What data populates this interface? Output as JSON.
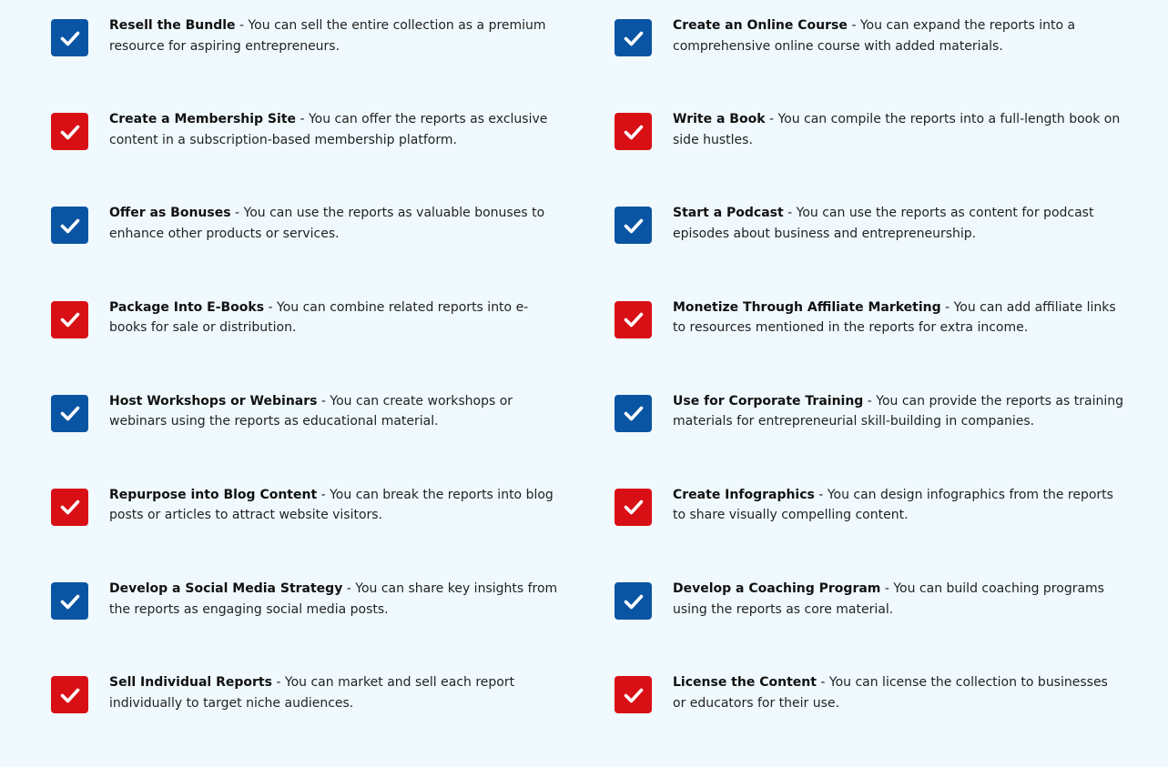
{
  "colors": {
    "background": "#f0fafe",
    "blue": "#0a55a3",
    "red": "#d90f16",
    "check": "#ffffff"
  },
  "separator": " - ",
  "items": [
    {
      "title": "Resell the Bundle",
      "desc": "You can sell the entire collection as a premium resource for aspiring entrepreneurs.",
      "color": "blue",
      "icon": "checkmark-icon"
    },
    {
      "title": "Create an Online Course",
      "desc": "You can expand the reports into a comprehensive online course with added materials.",
      "color": "blue",
      "icon": "checkmark-icon"
    },
    {
      "title": "Create a Membership Site",
      "desc": "You can offer the reports as exclusive content in a subscription-based membership platform.",
      "color": "red",
      "icon": "checkmark-icon"
    },
    {
      "title": "Write a Book",
      "desc": "You can compile the reports into a full-length book on side hustles.",
      "color": "red",
      "icon": "checkmark-icon"
    },
    {
      "title": "Offer as Bonuses",
      "desc": "You can use the reports as valuable bonuses to enhance other products or services.",
      "color": "blue",
      "icon": "checkmark-icon"
    },
    {
      "title": "Start a Podcast",
      "desc": "You can use the reports as content for podcast episodes about business and entrepreneurship.",
      "color": "blue",
      "icon": "checkmark-icon"
    },
    {
      "title": "Package Into E-Books",
      "desc": "You can combine related reports into e-books for sale or distribution.",
      "color": "red",
      "icon": "checkmark-icon"
    },
    {
      "title": "Monetize Through Affiliate Marketing",
      "desc": "You can add affiliate links to resources mentioned in the reports for extra income.",
      "color": "red",
      "icon": "checkmark-icon"
    },
    {
      "title": "Host Workshops or Webinars",
      "desc": "You can create workshops or webinars using the reports as educational material.",
      "color": "blue",
      "icon": "checkmark-icon"
    },
    {
      "title": "Use for Corporate Training",
      "desc": "You can provide the reports as training materials for entrepreneurial skill-building in companies.",
      "color": "blue",
      "icon": "checkmark-icon"
    },
    {
      "title": "Repurpose into Blog Content",
      "desc": "You can break the reports into blog posts or articles to attract website visitors.",
      "color": "red",
      "icon": "checkmark-icon"
    },
    {
      "title": "Create Infographics",
      "desc": "You can design infographics from the reports to share visually compelling content.",
      "color": "red",
      "icon": "checkmark-icon"
    },
    {
      "title": "Develop a Social Media Strategy",
      "desc": "You can share key insights from the reports as engaging social media posts.",
      "color": "blue",
      "icon": "checkmark-icon"
    },
    {
      "title": "Develop a Coaching Program",
      "desc": "You can build coaching programs using the reports as core material.",
      "color": "blue",
      "icon": "checkmark-icon"
    },
    {
      "title": "Sell Individual Reports",
      "desc": "You can market and sell each report individually to target niche audiences.",
      "color": "red",
      "icon": "checkmark-icon"
    },
    {
      "title": "License the Content",
      "desc": "You can license the collection to businesses or educators for their use.",
      "color": "red",
      "icon": "checkmark-icon"
    }
  ]
}
